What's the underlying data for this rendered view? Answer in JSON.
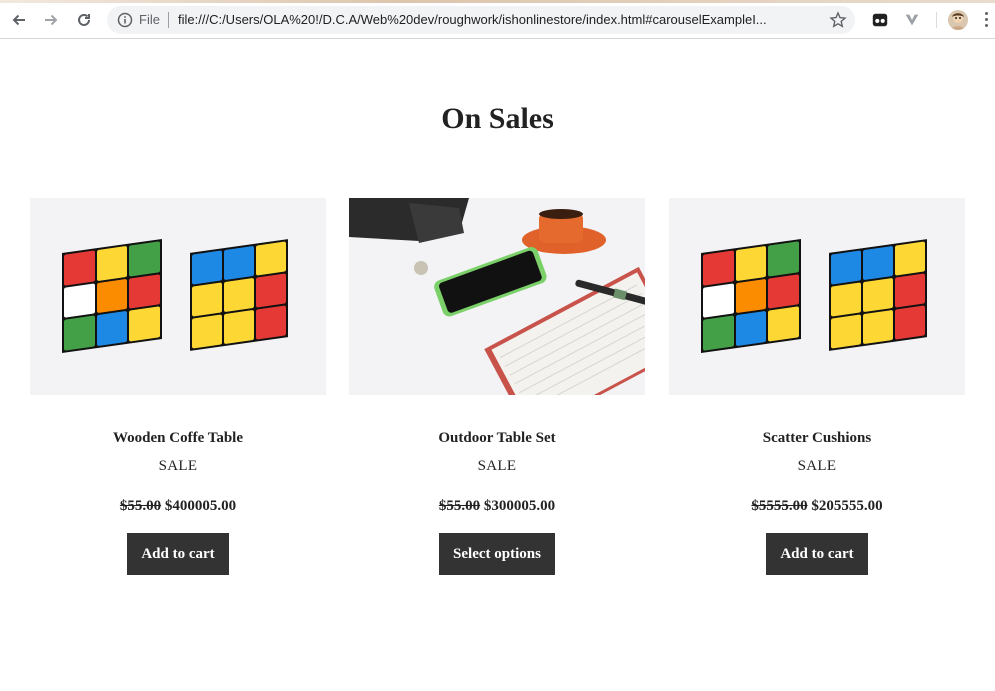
{
  "browser": {
    "scheme_label": "File",
    "url": "file:///C:/Users/OLA%20!/D.C.A/Web%20dev/roughwork/ishonlinestore/index.html#carouselExampleI..."
  },
  "section": {
    "title": "On Sales"
  },
  "products": [
    {
      "name": "Wooden Coffe Table",
      "badge": "SALE",
      "old_price": "$55.00",
      "price": "$400005.00",
      "button": "Add to cart",
      "image": "rubiks-cubes"
    },
    {
      "name": "Outdoor Table Set",
      "badge": "SALE",
      "old_price": "$55.00",
      "price": "$300005.00",
      "button": "Select options",
      "image": "desk-phone-coffee-notebook"
    },
    {
      "name": "Scatter Cushions",
      "badge": "SALE",
      "old_price": "$5555.00",
      "price": "$205555.00",
      "button": "Add to cart",
      "image": "rubiks-cubes"
    }
  ],
  "colors": {
    "button_bg": "#333333",
    "button_text": "#ffffff",
    "text": "#222222"
  }
}
